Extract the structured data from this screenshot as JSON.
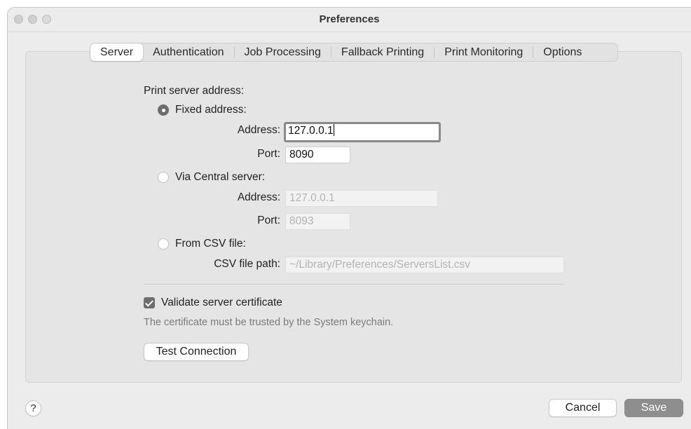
{
  "window": {
    "title": "Preferences"
  },
  "tabs": [
    {
      "label": "Server",
      "active": true
    },
    {
      "label": "Authentication",
      "active": false
    },
    {
      "label": "Job Processing",
      "active": false
    },
    {
      "label": "Fallback Printing",
      "active": false
    },
    {
      "label": "Print Monitoring",
      "active": false
    },
    {
      "label": "Options",
      "active": false
    }
  ],
  "server": {
    "section_label": "Print server address:",
    "fixed": {
      "radio_label": "Fixed address:",
      "selected": true,
      "address_label": "Address:",
      "address_value": "127.0.0.1",
      "port_label": "Port:",
      "port_value": "8090"
    },
    "central": {
      "radio_label": "Via Central server:",
      "selected": false,
      "address_label": "Address:",
      "address_placeholder": "127.0.0.1",
      "port_label": "Port:",
      "port_placeholder": "8093"
    },
    "csv": {
      "radio_label": "From CSV file:",
      "selected": false,
      "path_label": "CSV file path:",
      "path_placeholder": "~/Library/Preferences/ServersList.csv"
    },
    "validate": {
      "label": "Validate server certificate",
      "checked": true,
      "hint": "The certificate must be trusted by the System keychain."
    },
    "test_button": "Test Connection"
  },
  "footer": {
    "help": "?",
    "cancel": "Cancel",
    "save": "Save"
  },
  "colors": {
    "window_bg": "#ececec",
    "panel_bg": "#e5e5e5",
    "selected_control": "#6d6d6d",
    "primary_button": "#8e8e8e"
  }
}
